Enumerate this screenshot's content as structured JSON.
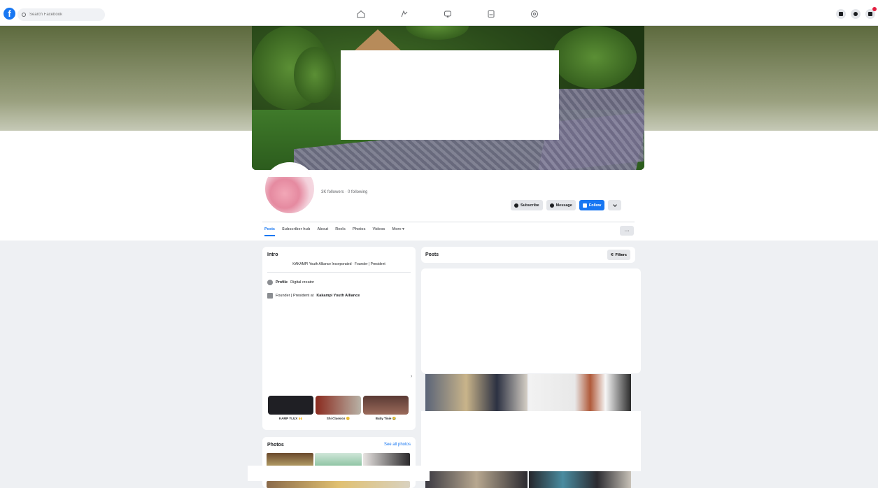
{
  "topbar": {
    "search_placeholder": "Search Facebook",
    "nav_icons": [
      "home-icon",
      "video-icon",
      "marketplace-icon",
      "groups-icon",
      "gaming-icon"
    ],
    "right_icons": [
      "menu-grid-icon",
      "messenger-icon",
      "notifications-icon"
    ]
  },
  "profile": {
    "followers_line": "3K followers · 0 following",
    "actions": {
      "subscribe": "Subscribe",
      "message": "Message",
      "follow": "Follow"
    }
  },
  "tabs": [
    "Posts",
    "Subscriber hub",
    "About",
    "Reels",
    "Photos",
    "Videos",
    "More ▾"
  ],
  "intro": {
    "title": "Intro",
    "bio": "KAKAMPI Youth Alliance Incorporated · Founder | President",
    "profile_label": "Profile",
    "profile_value": "Digital creator",
    "work_prefix": "Founder | President at",
    "work_org": "Kakampi Youth Alliance"
  },
  "highlights": [
    "KAMP YLUX 🙌",
    "Shi Classics 😊",
    "Baby Tinie 😂"
  ],
  "photos": {
    "title": "Photos",
    "see_all": "See all photos"
  },
  "posts": {
    "title": "Posts",
    "filters": "Filters"
  },
  "colors": {
    "accent": "#1877f2",
    "background": "#eef0f3"
  }
}
